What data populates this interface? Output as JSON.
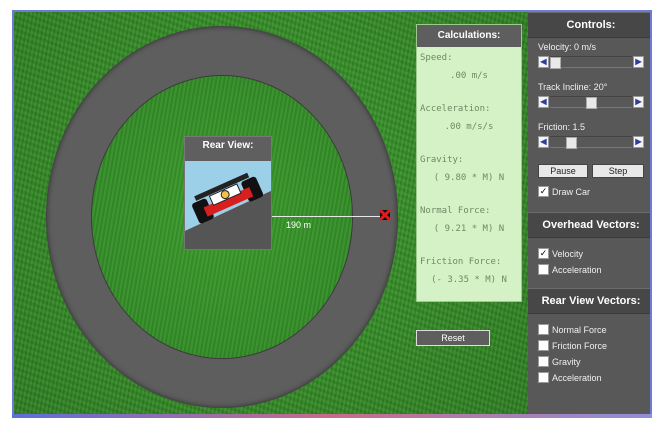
{
  "scene": {
    "radius_label": "190 m"
  },
  "rear_view": {
    "title": "Rear View:"
  },
  "calculations": {
    "title": "Calculations:",
    "speed_label": "Speed:",
    "speed_value": ".00 m/s",
    "accel_label": "Acceleration:",
    "accel_value": ".00 m/s/s",
    "gravity_label": "Gravity:",
    "gravity_value": "( 9.80 * M) N",
    "normal_label": "Normal Force:",
    "normal_value": "( 9.21 * M) N",
    "friction_label": "Friction Force:",
    "friction_value": "(- 3.35 * M) N"
  },
  "reset_label": "Reset",
  "controls": {
    "title": "Controls:",
    "velocity_label": "Velocity: 0 m/s",
    "incline_label": "Track Incline: 20°",
    "friction_label": "Friction: 1.5",
    "pause_label": "Pause",
    "step_label": "Step",
    "draw_car_label": "Draw Car"
  },
  "overhead": {
    "title": "Overhead Vectors:",
    "velocity_label": "Velocity",
    "acceleration_label": "Acceleration"
  },
  "rearview_vectors": {
    "title": "Rear View Vectors:",
    "normal_label": "Normal Force",
    "friction_label": "Friction Force",
    "gravity_label": "Gravity",
    "acceleration_label": "Acceleration"
  },
  "icons": {
    "left": "arrow-left-icon",
    "right": "arrow-right-icon",
    "check": "checkmark-icon"
  },
  "colors": {
    "grass": "#2f8322",
    "track": "#5e5e5e",
    "panel": "#585858",
    "calc_bg": "#d4f2c6"
  }
}
